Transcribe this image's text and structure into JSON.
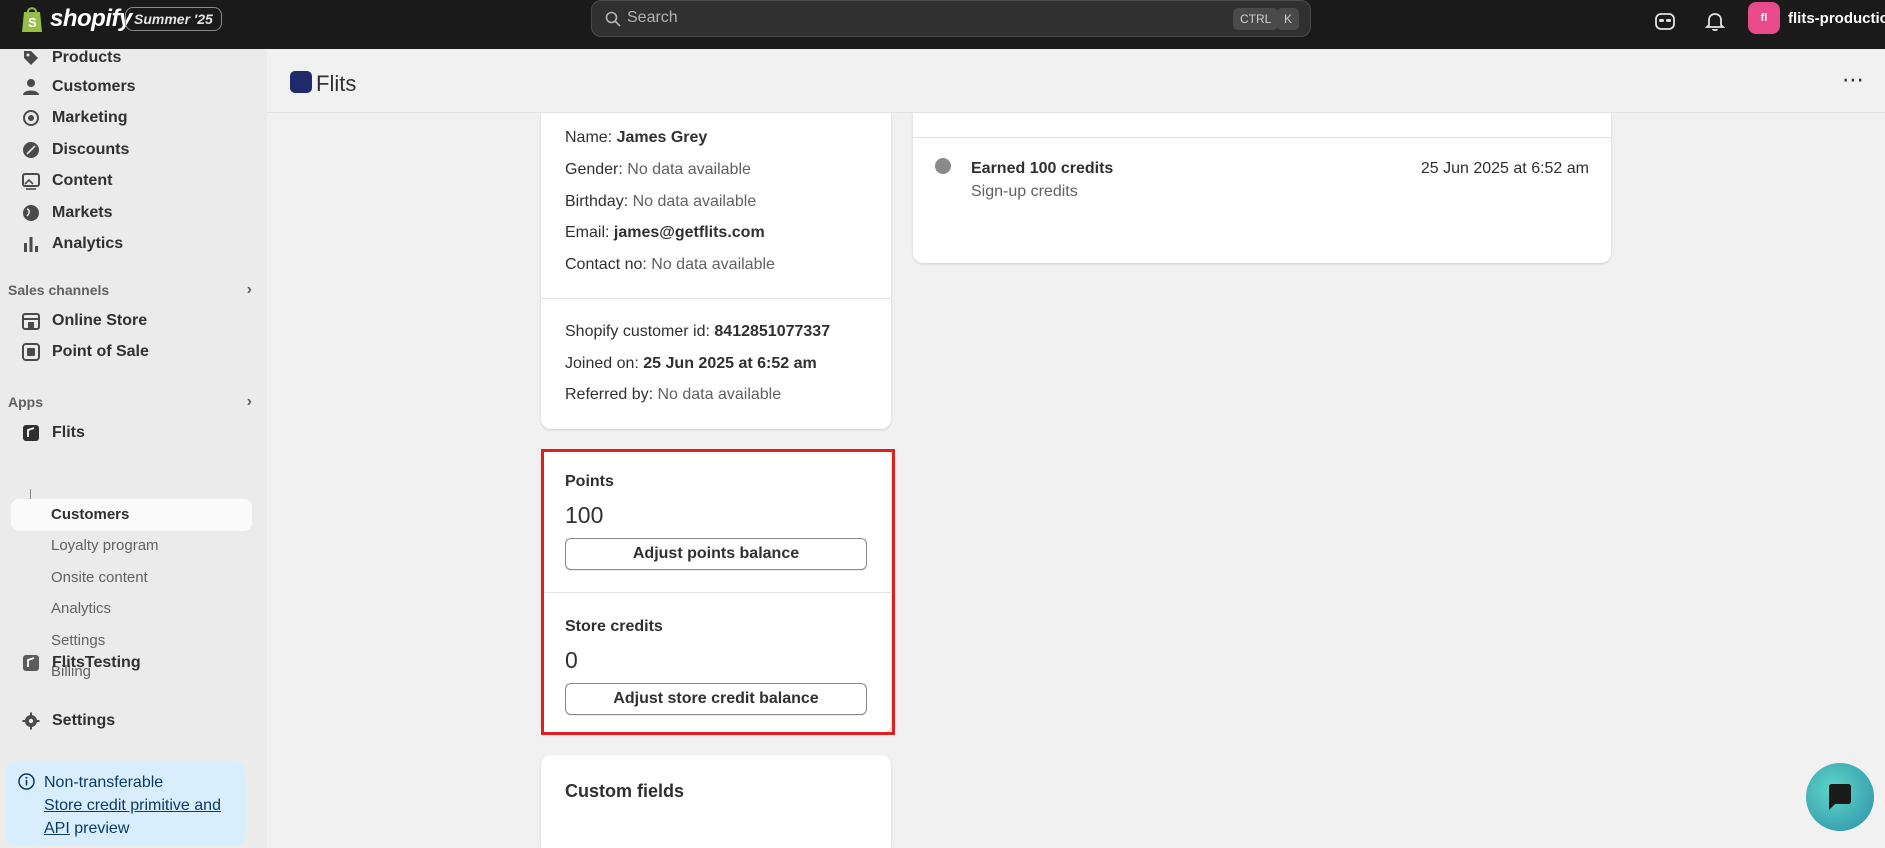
{
  "topbar": {
    "brand": "shopify",
    "edition": "Summer '25",
    "search_placeholder": "Search",
    "shortcut_ctrl": "CTRL",
    "shortcut_k": "K",
    "store_initials": "fl",
    "store_name": "flits-production"
  },
  "sidebar": {
    "items": [
      {
        "label": "Products",
        "icon": "tag-icon"
      },
      {
        "label": "Customers",
        "icon": "person-icon"
      },
      {
        "label": "Marketing",
        "icon": "target-icon"
      },
      {
        "label": "Discounts",
        "icon": "discount-icon"
      },
      {
        "label": "Content",
        "icon": "image-icon"
      },
      {
        "label": "Markets",
        "icon": "globe-icon"
      },
      {
        "label": "Analytics",
        "icon": "bar-chart-icon"
      }
    ],
    "sales_channels_title": "Sales channels",
    "sales_channels": [
      {
        "label": "Online Store",
        "icon": "store-icon"
      },
      {
        "label": "Point of Sale",
        "icon": "pos-icon"
      }
    ],
    "apps_title": "Apps",
    "app_name": "Flits",
    "app_subitems": [
      "Customers",
      "Loyalty program",
      "Onsite content",
      "Analytics",
      "Settings",
      "Billing"
    ],
    "app2_name": "FlitsTesting",
    "settings_label": "Settings",
    "banner": {
      "title": "Non-transferable",
      "link_text_1": "Store credit primitive and",
      "link_text_2": "API",
      "suffix": " preview"
    }
  },
  "page": {
    "title": "Flits",
    "more": "⋯"
  },
  "profile": {
    "name_label": "Name: ",
    "name": "James Grey",
    "gender_label": "Gender: ",
    "gender": "No data available",
    "birthday_label": "Birthday: ",
    "birthday": "No data available",
    "email_label": "Email: ",
    "email": "james@getflits.com",
    "contact_label": "Contact no: ",
    "contact": "No data available",
    "customer_id_label": "Shopify customer id: ",
    "customer_id": "8412851077337",
    "joined_label": "Joined on: ",
    "joined": "25 Jun 2025 at 6:52 am",
    "referred_label": "Referred by: ",
    "referred": "No data available"
  },
  "balances": {
    "points_label": "Points",
    "points_value": "100",
    "points_button": "Adjust points balance",
    "credits_label": "Store credits",
    "credits_value": "0",
    "credits_button": "Adjust store credit balance"
  },
  "custom_fields": {
    "title": "Custom fields"
  },
  "activity": {
    "title": "Earned 100 credits",
    "subtitle": "Sign-up credits",
    "time": "25 Jun 2025 at 6:52 am"
  },
  "colors": {
    "topbar": "#1a1a1a",
    "highlight": "#e02020",
    "banner_bg": "#d9eefc",
    "store_avatar": "#e94a8c"
  }
}
